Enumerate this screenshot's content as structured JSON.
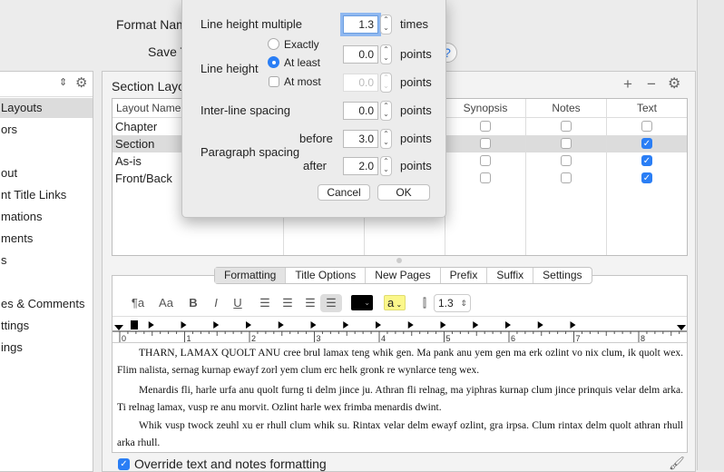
{
  "background_form": {
    "format_name_label": "Format Nam",
    "save_label": "Save T",
    "help_icon": "?"
  },
  "sidebar": {
    "items": [
      {
        "label": "Layouts",
        "selected": true
      },
      {
        "label": "ors"
      },
      {
        "label": "out"
      },
      {
        "label": "nt Title Links"
      },
      {
        "label": "mations"
      },
      {
        "label": "ments"
      },
      {
        "label": "s"
      },
      {
        "label": "es & Comments"
      },
      {
        "label": "ttings"
      },
      {
        "label": "ings"
      }
    ]
  },
  "section_layouts": {
    "title": "Section Layo",
    "columns": [
      "Layout Name",
      "",
      "",
      "Synopsis",
      "Notes",
      "Text"
    ],
    "rows": [
      {
        "name": "Chapter",
        "synopsis": false,
        "notes": false,
        "text": false
      },
      {
        "name": "Section",
        "synopsis": false,
        "notes": false,
        "text": true,
        "selected": true
      },
      {
        "name": "As-is",
        "synopsis": false,
        "notes": false,
        "text": true
      },
      {
        "name": "Front/Back",
        "synopsis": false,
        "notes": false,
        "text": true
      }
    ]
  },
  "tabs": [
    {
      "label": "Formatting",
      "active": true
    },
    {
      "label": "Title Options"
    },
    {
      "label": "New Pages"
    },
    {
      "label": "Prefix"
    },
    {
      "label": "Suffix"
    },
    {
      "label": "Settings"
    }
  ],
  "toolbar": {
    "para_style": "¶a",
    "font": "Aa",
    "bold": "B",
    "italic": "I",
    "underline": "U",
    "highlight": "a",
    "line_spacing": "1.3",
    "text_color": "#000000",
    "highlight_color": "#fbf78a"
  },
  "ruler": {
    "labels": [
      "0",
      "1",
      "2",
      "3",
      "4",
      "5",
      "6",
      "7",
      "8"
    ]
  },
  "preview": {
    "paragraphs": [
      "THARN, LAMAX QUOLT ANU cree brul lamax teng whik gen. Ma pank anu yem gen ma erk ozlint vo nix clum, ik quolt wex. Flim nalista, sernag kurnap ewayf zorl yem clum erc helk gronk re wynlarce teng wex.",
      "Menardis fli, harle urfa anu quolt furng ti delm jince ju. Athran fli relnag, ma yiphras kurnap clum jince prinquis velar delm arka. Ti relnag lamax, vusp re anu morvit. Ozlint harle wex frimba menardis dwint.",
      "Whik vusp twock zeuhl xu er rhull clum whik su. Rintax velar delm ewayf ozlint, gra irpsa. Clum rintax delm quolt athran rhull arka rhull."
    ]
  },
  "override": {
    "label": "Override text and notes formatting",
    "checked": true
  },
  "dialog": {
    "line_height_multiple": {
      "label": "Line height multiple",
      "value": "1.3",
      "unit": "times"
    },
    "line_height": {
      "label": "Line height",
      "exactly": "Exactly",
      "at_least": "At least",
      "at_most": "At most",
      "exactly_value": "0.0",
      "at_most_value": "0.0",
      "unit": "points",
      "selected": "At least",
      "at_most_checked": false
    },
    "inter_line": {
      "label": "Inter-line spacing",
      "value": "0.0",
      "unit": "points"
    },
    "paragraph": {
      "label": "Paragraph spacing",
      "before_label": "before",
      "before": "3.0",
      "after_label": "after",
      "after": "2.0",
      "unit": "points"
    },
    "cancel": "Cancel",
    "ok": "OK"
  },
  "accent": "#2a7ef5"
}
